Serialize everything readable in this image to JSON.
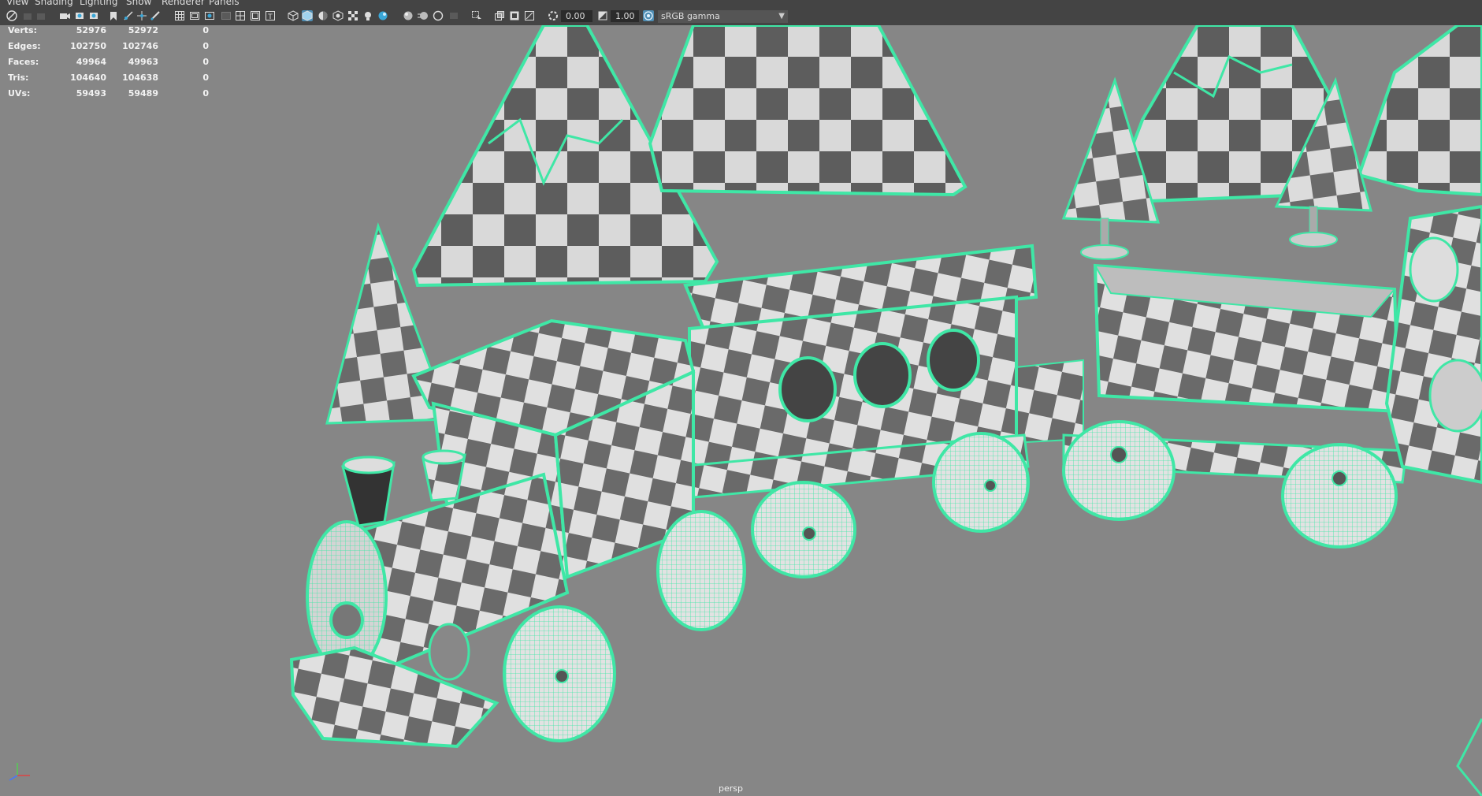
{
  "menu": {
    "items": [
      "View",
      "Shading",
      "Lighting",
      "Show",
      "Renderer",
      "Panels"
    ]
  },
  "toolbar": {
    "exposure_value": "0.00",
    "gamma_value": "1.00",
    "color_space": "sRGB gamma",
    "icons": [
      "select-camera-icon",
      "camera-attributes-icon",
      "bookmarks-icon",
      "image-plane-icon",
      "grid-icon",
      "film-gate-icon",
      "resolution-gate-icon",
      "gate-mask-icon",
      "field-chart-icon",
      "safe-action-icon",
      "safe-title-icon",
      "wireframe-icon",
      "smooth-shade-icon",
      "wireframe-on-shaded-icon",
      "textured-icon",
      "lights-icon",
      "shadows-icon",
      "screen-ambient-occlusion-icon",
      "motion-blur-icon",
      "anti-aliasing-icon",
      "depth-of-field-icon",
      "isolate-select-icon",
      "xray-icon",
      "xray-joints-icon",
      "backface-culling-icon",
      "exposure-icon",
      "gamma-icon",
      "color-management-icon"
    ]
  },
  "hud": {
    "rows": [
      {
        "label": "Verts:",
        "total": "52976",
        "selected": "52972",
        "tri_count": "0"
      },
      {
        "label": "Edges:",
        "total": "102750",
        "selected": "102746",
        "tri_count": "0"
      },
      {
        "label": "Faces:",
        "total": "49964",
        "selected": "49963",
        "tri_count": "0"
      },
      {
        "label": "Tris:",
        "total": "104640",
        "selected": "104638",
        "tri_count": "0"
      },
      {
        "label": "UVs:",
        "total": "59493",
        "selected": "59489",
        "tri_count": "0"
      }
    ]
  },
  "viewport": {
    "camera_label": "persp",
    "background_color": "#868686",
    "wire_color": "#3fe7a6"
  }
}
